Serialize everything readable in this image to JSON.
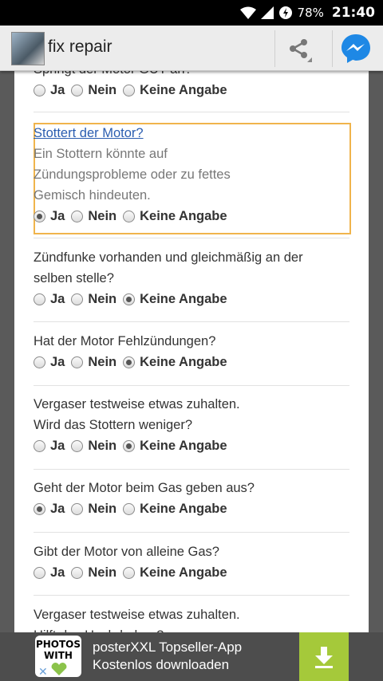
{
  "status": {
    "battery": "78%",
    "time": "21:40"
  },
  "app": {
    "title": "fix repair"
  },
  "options": {
    "ja": "Ja",
    "nein": "Nein",
    "keine": "Keine Angabe"
  },
  "questions": [
    {
      "title": "Springt der Motor GUT an?",
      "hint": "",
      "selected": "ja"
    },
    {
      "title": "Stottert der Motor?",
      "hint1": "Ein Stottern könnte auf",
      "hint2": "Zündungsprobleme oder zu fettes",
      "hint3": "Gemisch hindeuten.",
      "selected": "ja"
    },
    {
      "title1": "Zündfunke vorhanden und gleichmäßig an der",
      "title2": "selben stelle?",
      "selected": "keine"
    },
    {
      "title": "Hat der Motor Fehlzündungen?",
      "selected": "keine"
    },
    {
      "title1": "Vergaser testweise etwas zuhalten.",
      "title2": "Wird das Stottern weniger?",
      "selected": "keine"
    },
    {
      "title": "Geht der Motor beim Gas geben aus?",
      "selected": "ja"
    },
    {
      "title": "Gibt der Motor von alleine Gas?",
      "selected": "none"
    },
    {
      "title1": "Vergaser testweise etwas zuhalten.",
      "title2": "Hilft das Hochdrehen?"
    }
  ],
  "ad": {
    "logo": "PHOTOS WITH",
    "line1": "posterXXL Topseller-App",
    "line2": "Kostenlos downloaden"
  }
}
